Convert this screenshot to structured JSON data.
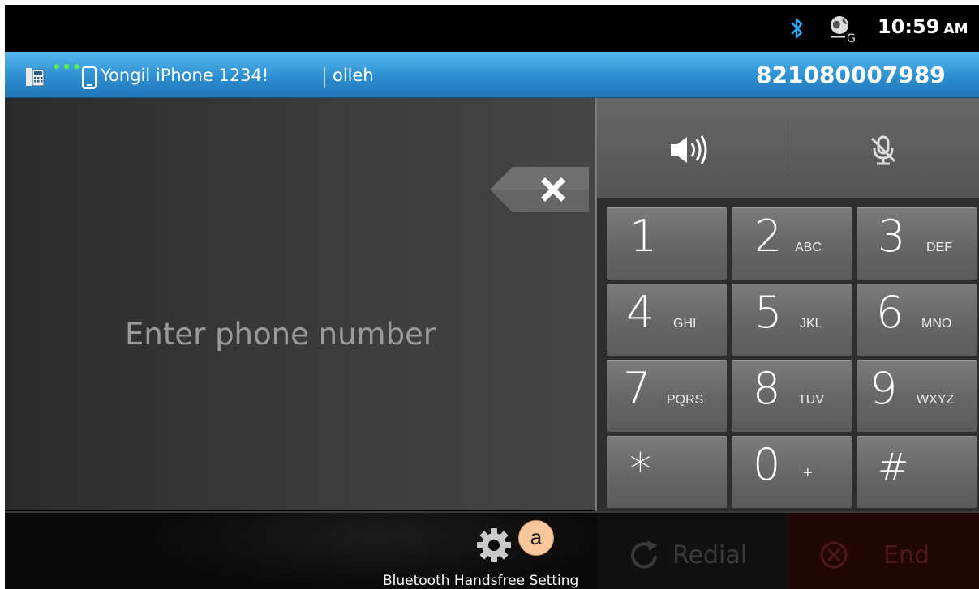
{
  "status_bar": {
    "icons": [
      "bluetooth-icon",
      "globe-location-icon"
    ],
    "time": "10:59",
    "ampm": "AM"
  },
  "info_bar": {
    "device_name": "Yongil iPhone 1234!",
    "carrier": "olleh",
    "own_number": "821080007989",
    "icons": [
      "phone-device-icon",
      "signal-dots",
      "handset-icon"
    ],
    "dots": "•••"
  },
  "display": {
    "placeholder": "Enter phone number",
    "backspace_icon": "backspace-x-icon"
  },
  "audio": {
    "speaker_icon": "speaker-icon",
    "mute_icon": "mute-microphone-icon"
  },
  "keypad": {
    "keys": [
      {
        "digit": "1",
        "letters": ""
      },
      {
        "digit": "2",
        "letters": "ABC"
      },
      {
        "digit": "3",
        "letters": "DEF"
      },
      {
        "digit": "4",
        "letters": "GHI"
      },
      {
        "digit": "5",
        "letters": "JKL"
      },
      {
        "digit": "6",
        "letters": "MNO"
      },
      {
        "digit": "7",
        "letters": "PQRS"
      },
      {
        "digit": "8",
        "letters": "TUV"
      },
      {
        "digit": "9",
        "letters": "WXYZ"
      },
      {
        "digit": "*",
        "letters": ""
      },
      {
        "digit": "0",
        "letters": "+"
      },
      {
        "digit": "#",
        "letters": ""
      }
    ]
  },
  "bottom_bar": {
    "settings_label": "Bluetooth Handsfree Setting",
    "badge": "a",
    "redial_label": "Redial",
    "end_label": "End"
  },
  "colors": {
    "info_bar": "#2c8fd0",
    "signal_dots": "#57f04a",
    "badge": "#f7c79b",
    "end_button": "#230606"
  }
}
